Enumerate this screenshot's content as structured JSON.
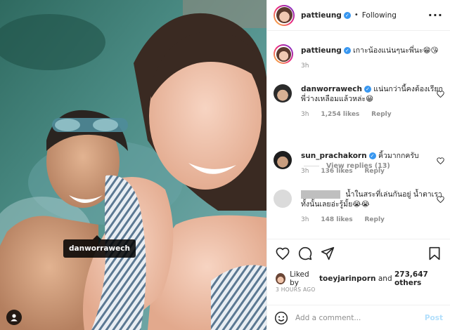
{
  "post": {
    "owner": "pattieung",
    "follow_status": "Following",
    "more_icon": "more-horizontal-icon",
    "photo_tag": "danworrawech"
  },
  "caption": {
    "user": "pattieung",
    "text": "เกาะน้องแน่นๆนะพี่นะ😁😘",
    "age": "3h"
  },
  "comments": [
    {
      "user": "danworrawech",
      "text": "แน่นกว่านี้คงต้องเรียกพี่ว่างเหลือมแล้วหล่ะ😁",
      "age": "3h",
      "likes": "1,254 likes",
      "reply": "Reply",
      "view_replies": "View replies (13)"
    },
    {
      "user": "sun_prachakorn",
      "text": "คิ้วมากกครับ",
      "age": "3h",
      "likes": "136 likes",
      "reply": "Reply"
    },
    {
      "user": "",
      "text": "น้ำในสระที่เล่นกันอยู่ น้ำตาเราทั้งนั้นเลยอ่ะรู้มั้ย😭😭",
      "age": "3h",
      "likes": "148 likes",
      "reply": "Reply"
    }
  ],
  "likes": {
    "prefix": "Liked by",
    "user": "toeyjarinporn",
    "and": "and",
    "others": "273,647 others"
  },
  "timestamp": "3 HOURS AGO",
  "add_comment": {
    "placeholder": "Add a comment...",
    "post_label": "Post"
  },
  "colors": {
    "link_blue": "#3897f0",
    "post_disabled": "#b2dffc",
    "muted": "#8e8e8e"
  }
}
